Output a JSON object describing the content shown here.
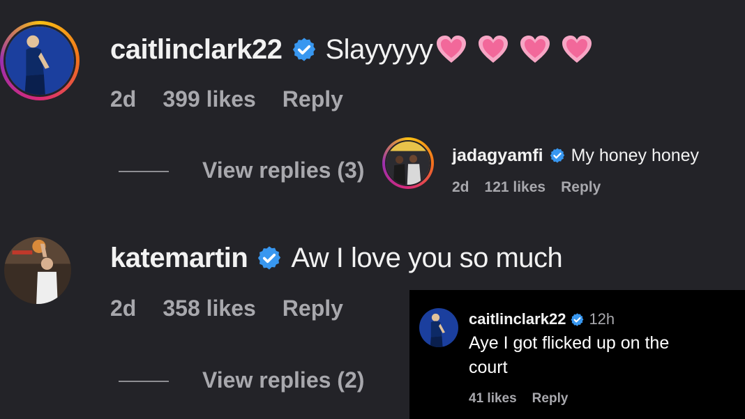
{
  "comments": [
    {
      "username": "caitlinclark22",
      "text": "Slayyyyy",
      "hearts": 4,
      "time": "2d",
      "likes": "399 likes",
      "reply": "Reply",
      "view_replies": "View replies (3)"
    },
    {
      "username": "katemartin",
      "text": "Aw I love you so much",
      "time": "2d",
      "likes": "358 likes",
      "reply": "Reply",
      "view_replies": "View replies (2)"
    }
  ],
  "inline_reply": {
    "username": "jadagyamfi",
    "text": "My honey honey",
    "time": "2d",
    "likes": "121 likes",
    "reply": "Reply"
  },
  "overlay_reply": {
    "username": "caitlinclark22",
    "time": "12h",
    "text_line1": "Aye I got flicked up on the",
    "text_line2": "court",
    "likes": "41 likes",
    "reply": "Reply"
  },
  "colors": {
    "background": "#232328",
    "verified": "#3897f0",
    "heart": "#f7a6c5",
    "muted": "#a8a8ad"
  },
  "icons": [
    "verified-badge-icon",
    "pink-heart-icon"
  ]
}
